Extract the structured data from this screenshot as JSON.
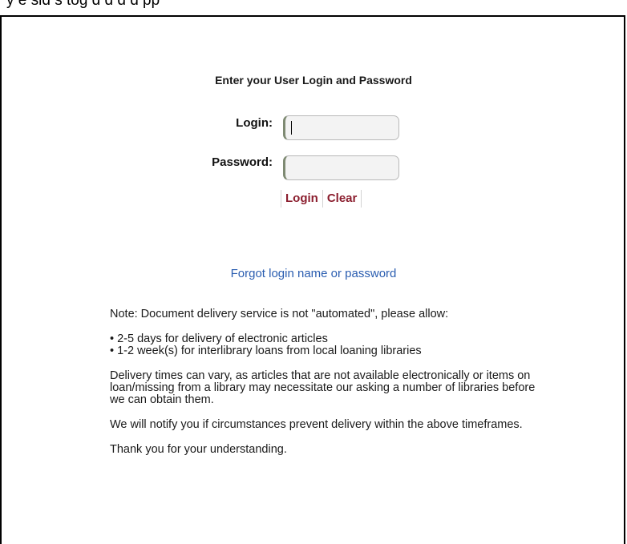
{
  "page": {
    "top_caption": "y e sid s tog d d d d pp"
  },
  "form": {
    "heading": "Enter your User Login and Password",
    "login_label": "Login:",
    "login_value": "",
    "password_label": "Password:",
    "password_value": "",
    "login_button": "Login",
    "clear_button": "Clear"
  },
  "links": {
    "forgot": "Forgot login name or password"
  },
  "notes": {
    "intro": "Note: Document delivery service is not \"automated\", please allow:",
    "bullet_1": "• 2-5 days for delivery of electronic articles",
    "bullet_2": "• 1-2 week(s) for interlibrary loans from local loaning libraries",
    "delivery": "Delivery times can vary, as articles that are not available electronically or items on loan/missing from a library may necessitate our asking a number of libraries before we can obtain them.",
    "notify": "We will notify you if circumstances prevent delivery within the above timeframes.",
    "thanks": "Thank you for your understanding."
  },
  "colors": {
    "button_text": "#8b1e2e",
    "link_text": "#2a5db0",
    "input_bg": "#f3f3f3",
    "input_accent_border": "#7e8a72"
  }
}
